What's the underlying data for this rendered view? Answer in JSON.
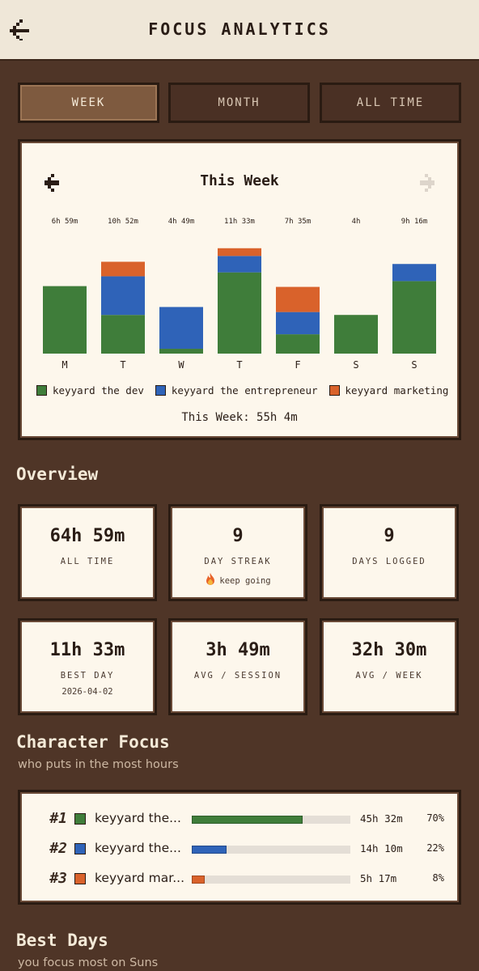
{
  "header": {
    "title": "FOCUS ANALYTICS"
  },
  "tabs": [
    {
      "label": "WEEK",
      "active": true
    },
    {
      "label": "MONTH",
      "active": false
    },
    {
      "label": "ALL TIME",
      "active": false
    }
  ],
  "chart_card": {
    "title": "This Week",
    "total": "This Week: 55h 4m",
    "prev_icon": "arrow-left-icon",
    "next_icon": "arrow-right-icon"
  },
  "chart_data": {
    "type": "bar",
    "stacked": true,
    "categories": [
      "M",
      "T",
      "W",
      "T",
      "F",
      "S",
      "S"
    ],
    "totals": [
      "6h 59m",
      "10h 52m",
      "4h 49m",
      "11h 33m",
      "7h 35m",
      "4h",
      "9h 16m"
    ],
    "series": [
      {
        "name": "keyyard the dev",
        "color": "#3f7d3a",
        "values": [
          6.98,
          4.0,
          0.5,
          8.4,
          2.0,
          4.0,
          7.5
        ]
      },
      {
        "name": "keyyard the entrepreneur",
        "color": "#2f63b8",
        "values": [
          0,
          4.0,
          4.32,
          1.7,
          2.3,
          0,
          1.77
        ]
      },
      {
        "name": "keyyard marketing",
        "color": "#d9622b",
        "values": [
          0,
          1.5,
          0,
          0.8,
          2.6,
          0,
          0
        ]
      }
    ],
    "ylim": [
      0,
      11.55
    ]
  },
  "overview": {
    "title": "Overview",
    "stats": [
      {
        "value": "64h 59m",
        "label": "ALL TIME",
        "sub": ""
      },
      {
        "value": "9",
        "label": "DAY STREAK",
        "sub": "keep going",
        "sub_icon": "flame-icon"
      },
      {
        "value": "9",
        "label": "DAYS LOGGED",
        "sub": ""
      },
      {
        "value": "11h 33m",
        "label": "BEST DAY",
        "sub": "2026-04-02"
      },
      {
        "value": "3h 49m",
        "label": "AVG / SESSION",
        "sub": ""
      },
      {
        "value": "32h 30m",
        "label": "AVG / WEEK",
        "sub": ""
      }
    ]
  },
  "character_focus": {
    "title": "Character Focus",
    "subtitle": "who puts in the most hours",
    "rows": [
      {
        "rank": "#1",
        "name": "keyyard the...",
        "color": "#3f7d3a",
        "time": "45h 32m",
        "pct": "70%",
        "fraction": 0.7
      },
      {
        "rank": "#2",
        "name": "keyyard the...",
        "color": "#2f63b8",
        "time": "14h 10m",
        "pct": "22%",
        "fraction": 0.22
      },
      {
        "rank": "#3",
        "name": "keyyard mar...",
        "color": "#d9622b",
        "time": "5h 17m",
        "pct": "8%",
        "fraction": 0.08
      }
    ]
  },
  "best_days": {
    "title": "Best Days",
    "subtitle": "you focus most on Suns"
  }
}
